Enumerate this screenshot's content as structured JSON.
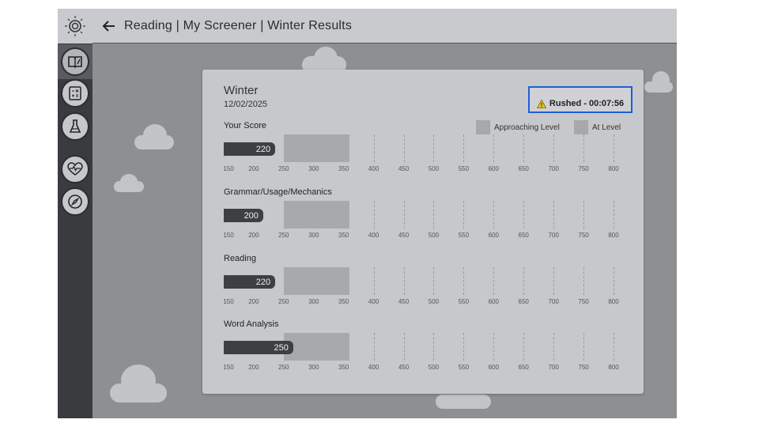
{
  "header": {
    "title": "Reading | My Screener | Winter Results"
  },
  "sidebar": {
    "items": [
      {
        "name": "sidebar-item-reading",
        "icon": "book-icon"
      },
      {
        "name": "sidebar-item-math",
        "icon": "calculator-icon"
      },
      {
        "name": "sidebar-item-science",
        "icon": "flask-icon"
      },
      {
        "name": "sidebar-item-health",
        "icon": "heartbeat-icon"
      },
      {
        "name": "sidebar-item-explore",
        "icon": "compass-icon"
      }
    ]
  },
  "card": {
    "season": "Winter",
    "date": "12/02/2025",
    "rushed": "Rushed - 00:07:56",
    "legend": {
      "approaching": "Approaching Level",
      "at": "At Level"
    }
  },
  "axis_ticks": [
    "150",
    "200",
    "250",
    "300",
    "350",
    "400",
    "450",
    "500",
    "550",
    "600",
    "650",
    "700",
    "750",
    "800"
  ],
  "chart_data": {
    "type": "bar",
    "xlim": [
      150,
      800
    ],
    "categories": [
      "Your Score",
      "Grammar/Usage/Mechanics",
      "Reading",
      "Word Analysis"
    ],
    "values": [
      220,
      200,
      220,
      250
    ],
    "approaching_band": [
      250,
      360
    ],
    "colors": {
      "bar": "#3e3f43",
      "approaching": "#a8a9ad",
      "accent": "#1f5fd6"
    }
  }
}
